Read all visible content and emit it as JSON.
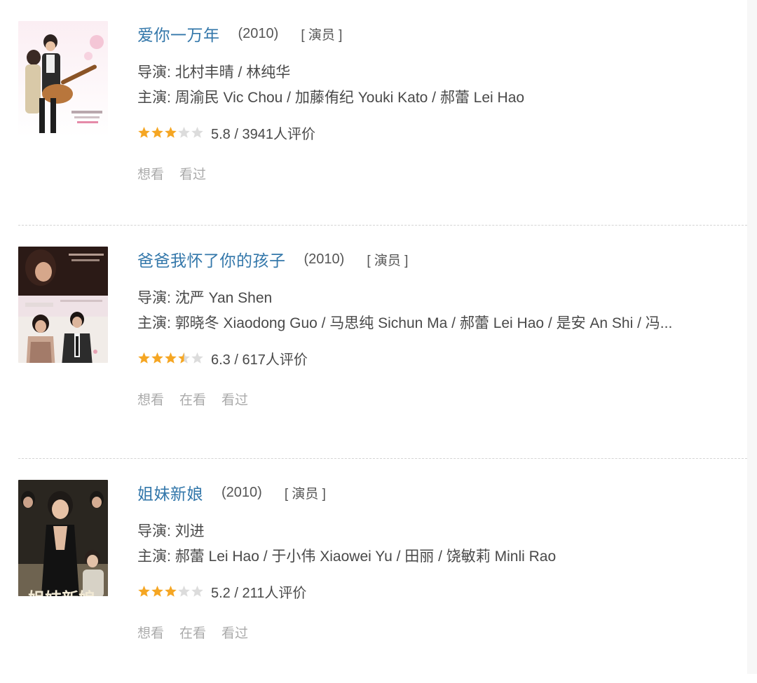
{
  "colors": {
    "link": "#3377aa",
    "star_on": "#f5a623",
    "star_off": "#dcdcdc",
    "muted": "#aaaaaa"
  },
  "labels": {
    "director": "导演:",
    "cast": "主演:"
  },
  "movies": [
    {
      "title": "爱你一万年",
      "year": "(2010)",
      "role": "[ 演员 ]",
      "director": "北村丰晴 / 林纯华",
      "cast": "周渝民 Vic Chou / 加藤侑纪 Youki Kato / 郝蕾 Lei Hao",
      "rating": 5.8,
      "stars_out_of_5": 3,
      "rating_text": "5.8 / 3941人评价",
      "actions": [
        "想看",
        "看过"
      ],
      "poster_text": "爱你一萬年"
    },
    {
      "title": "爸爸我怀了你的孩子",
      "year": "(2010)",
      "role": "[ 演员 ]",
      "director": "沈严 Yan Shen",
      "cast": "郭晓冬 Xiaodong Guo / 马思纯 Sichun Ma / 郝蕾 Lei Hao / 是安 An Shi / 冯...",
      "rating": 6.3,
      "stars_out_of_5": 3.5,
      "rating_text": "6.3 / 617人评价",
      "actions": [
        "想看",
        "在看",
        "看过"
      ],
      "poster_text": "爸爸我怀了你的孩子"
    },
    {
      "title": "姐妹新娘",
      "year": "(2010)",
      "role": "[ 演员 ]",
      "director": "刘进",
      "cast": "郝蕾 Lei Hao / 于小伟 Xiaowei Yu / 田丽 / 饶敏莉 Minli Rao",
      "rating": 5.2,
      "stars_out_of_5": 3,
      "rating_text": "5.2 / 211人评价",
      "actions": [
        "想看",
        "在看",
        "看过"
      ],
      "poster_text": "姐妹新娘"
    }
  ]
}
